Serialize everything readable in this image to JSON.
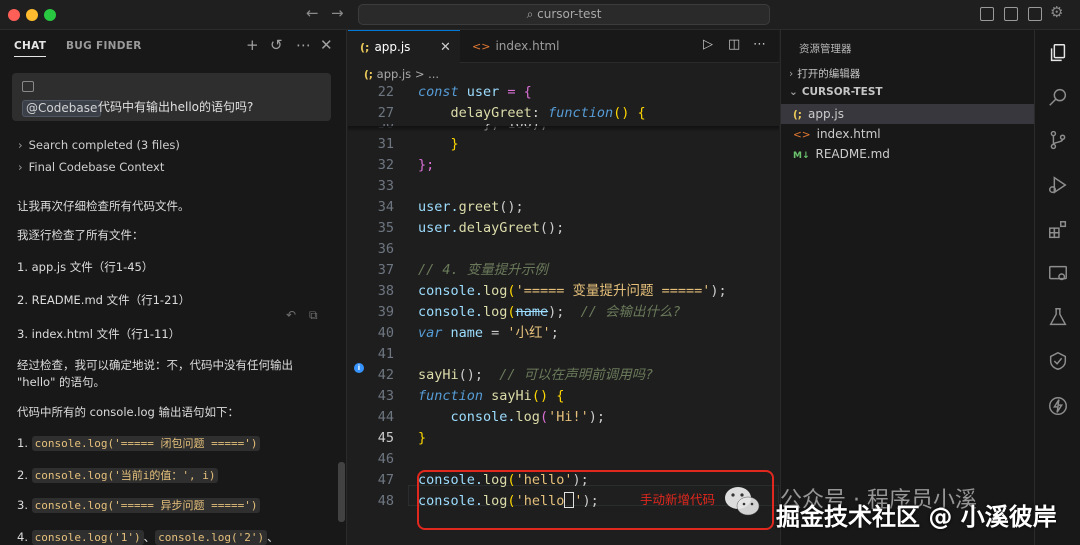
{
  "titlebar": {
    "search": "cursor-test"
  },
  "chat": {
    "tabs": {
      "chat": "CHAT",
      "bug_finder": "BUG FINDER"
    },
    "query": {
      "tag": "@Codebase",
      "text": "代码中有输出hello的语句吗?"
    },
    "collapsibles": [
      "Search completed (3 files)",
      "Final Codebase Context"
    ],
    "messages": {
      "m1": "让我再次仔细检查所有代码文件。",
      "m2": "我逐行检查了所有文件：",
      "m3": "1. app.js 文件（行1-45）",
      "m4": "2. README.md 文件（行1-21）",
      "m5": "3. index.html 文件（行1-11）",
      "m6a": "经过检查，我可以确定地说：不，代码中没有任何输出",
      "m6b": "\"hello\" 的语句。",
      "m7": "代码中所有的 console.log 输出语句如下：",
      "list1_num": "1.",
      "list1_code": "console.log('===== 闭包问题 =====')",
      "list2_num": "2.",
      "list2_code": "console.log('当前i的值：', i)",
      "list3_num": "3.",
      "list3_code": "console.log('===== 异步问题 =====')",
      "list4_num": "4.",
      "list4_code_a": "console.log('1')",
      "list4_sep": "、",
      "list4_code_b": "console.log('2')",
      "list4_tail": "、"
    }
  },
  "editor": {
    "tabs": [
      {
        "icon": "(;",
        "label": "app.js"
      },
      {
        "icon": "<>",
        "label": "index.html"
      }
    ],
    "breadcrumb": {
      "icon": "(;",
      "file": "app.js",
      "sep": ">",
      "rest": "..."
    },
    "lines": {
      "l22": "22",
      "l27": "27",
      "l30": "30",
      "l31": "31",
      "l32": "32",
      "l33": "33",
      "l34": "34",
      "l35": "35",
      "l36": "36",
      "l37": "37",
      "l38": "38",
      "l39": "39",
      "l40": "40",
      "l41": "41",
      "l42": "42",
      "l43": "43",
      "l44": "44",
      "l45": "45",
      "l46": "46",
      "l47": "47",
      "l48": "48"
    },
    "code": {
      "c22_kw": "const",
      "c22_var": " user",
      "c22_rest": " = {",
      "c27_prop": "    delayGreet",
      "c27_colon": ": ",
      "c27_kw": "function",
      "c27_rest": "() {",
      "c30": "        }, 100);",
      "c31": "    }",
      "c32": "};",
      "c34_obj": "user.",
      "c34_fn": "greet",
      "c34_rest": "();",
      "c35_obj": "user.",
      "c35_fn": "delayGreet",
      "c35_rest": "();",
      "c37": "// 4. 变量提升示例",
      "c38_obj": "console.",
      "c38_fn": "log",
      "c38_p": "(",
      "c38_str": "'===== 变量提升问题 ====='",
      "c38_end": ");",
      "c39_obj": "console.",
      "c39_fn": "log",
      "c39_p": "(",
      "c39_var": "name",
      "c39_end": ");",
      "c39_com": "  // 会输出什么?",
      "c40_kw": "var",
      "c40_var": " name",
      "c40_eq": " = ",
      "c40_str": "'小红'",
      "c40_end": ";",
      "c42_fn": "sayHi",
      "c42_rest": "();",
      "c42_com": "  // 可以在声明前调用吗?",
      "c43_kw": "function",
      "c43_fn": " sayHi",
      "c43_rest": "() {",
      "c44_obj": "    console.",
      "c44_fn": "log",
      "c44_p": "(",
      "c44_str": "'Hi!'",
      "c44_end": ");",
      "c45": "}",
      "c47_obj": "console.",
      "c47_fn": "log",
      "c47_p": "(",
      "c47_str": "'hello'",
      "c47_end": ");",
      "c48_obj": "console.",
      "c48_fn": "log",
      "c48_p": "(",
      "c48_str": "'hello",
      "c48_str_end": "'",
      "c48_end": ");"
    },
    "annotation": "手动新增代码"
  },
  "explorer": {
    "title": "资源管理器",
    "open_editors": "打开的编辑器",
    "project": "CURSOR-TEST",
    "files": [
      {
        "icon": "(;",
        "name": "app.js"
      },
      {
        "icon": "<>",
        "name": "index.html"
      },
      {
        "icon": "M↓",
        "name": "README.md"
      }
    ]
  },
  "watermark": {
    "line1": "公众号 · 程序员小溪",
    "line2": "掘金技术社区 @ 小溪彼岸"
  }
}
